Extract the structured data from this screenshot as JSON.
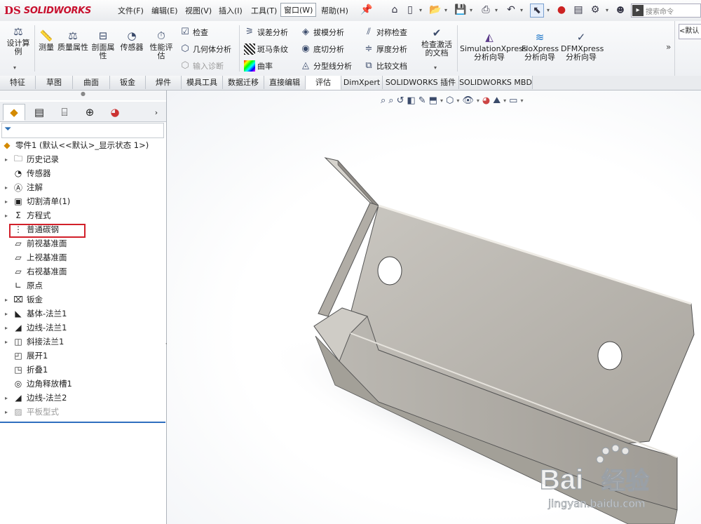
{
  "app": {
    "logo_ds": "DS",
    "logo_text": "SOLIDWORKS"
  },
  "menu": [
    "文件(F)",
    "编辑(E)",
    "视图(V)",
    "插入(I)",
    "工具(T)",
    "窗口(W)",
    "帮助(H)"
  ],
  "search": {
    "placeholder": "搜索命令"
  },
  "ribbon": {
    "design_study": "设计算例",
    "measure": "测量",
    "mass_props": "质量属性",
    "section_props": "剖面属性",
    "sensor": "传感器",
    "perf_eval": "性能评估",
    "check": "检查",
    "geometry_analysis": "几何体分析",
    "import_diag": "输入诊断",
    "deviation": "误差分析",
    "zebra": "斑马条纹",
    "curvature": "曲率",
    "draft": "拔模分析",
    "undercut": "底切分析",
    "parting_line": "分型线分析",
    "symmetry": "对称检查",
    "thickness": "厚度分析",
    "compare": "比较文档",
    "check_active": "检查激活的文档",
    "simxpress": "SimulationXpress分析向导",
    "floxpress": "FloXpress分析向导",
    "dfmxpress": "DFMXpress分析向导",
    "more": "»",
    "right_btn": "<默认"
  },
  "tabs": [
    "特征",
    "草图",
    "曲面",
    "钣金",
    "焊件",
    "模具工具",
    "数据迁移",
    "直接编辑",
    "评估",
    "DimXpert",
    "SOLIDWORKS 插件",
    "SOLIDWORKS MBD"
  ],
  "tree": {
    "root": "零件1 (默认<<默认>_显示状态 1>)",
    "items": [
      "历史记录",
      "传感器",
      "注解",
      "切割清单(1)",
      "方程式",
      "普通碳钢",
      "前视基准面",
      "上视基准面",
      "右视基准面",
      "原点",
      "钣金",
      "基体-法兰1",
      "边线-法兰1",
      "斜接法兰1",
      "展开1",
      "折叠1",
      "边角释放槽1",
      "边线-法兰2",
      "平板型式"
    ]
  },
  "watermark": {
    "brand_a": "Bai",
    "brand_b": "经验",
    "url": "jingyan.baidu.com"
  },
  "colors": {
    "highlight": "#d2202a",
    "brand_red": "#c8102e",
    "part_face": "#bdb9b2"
  }
}
